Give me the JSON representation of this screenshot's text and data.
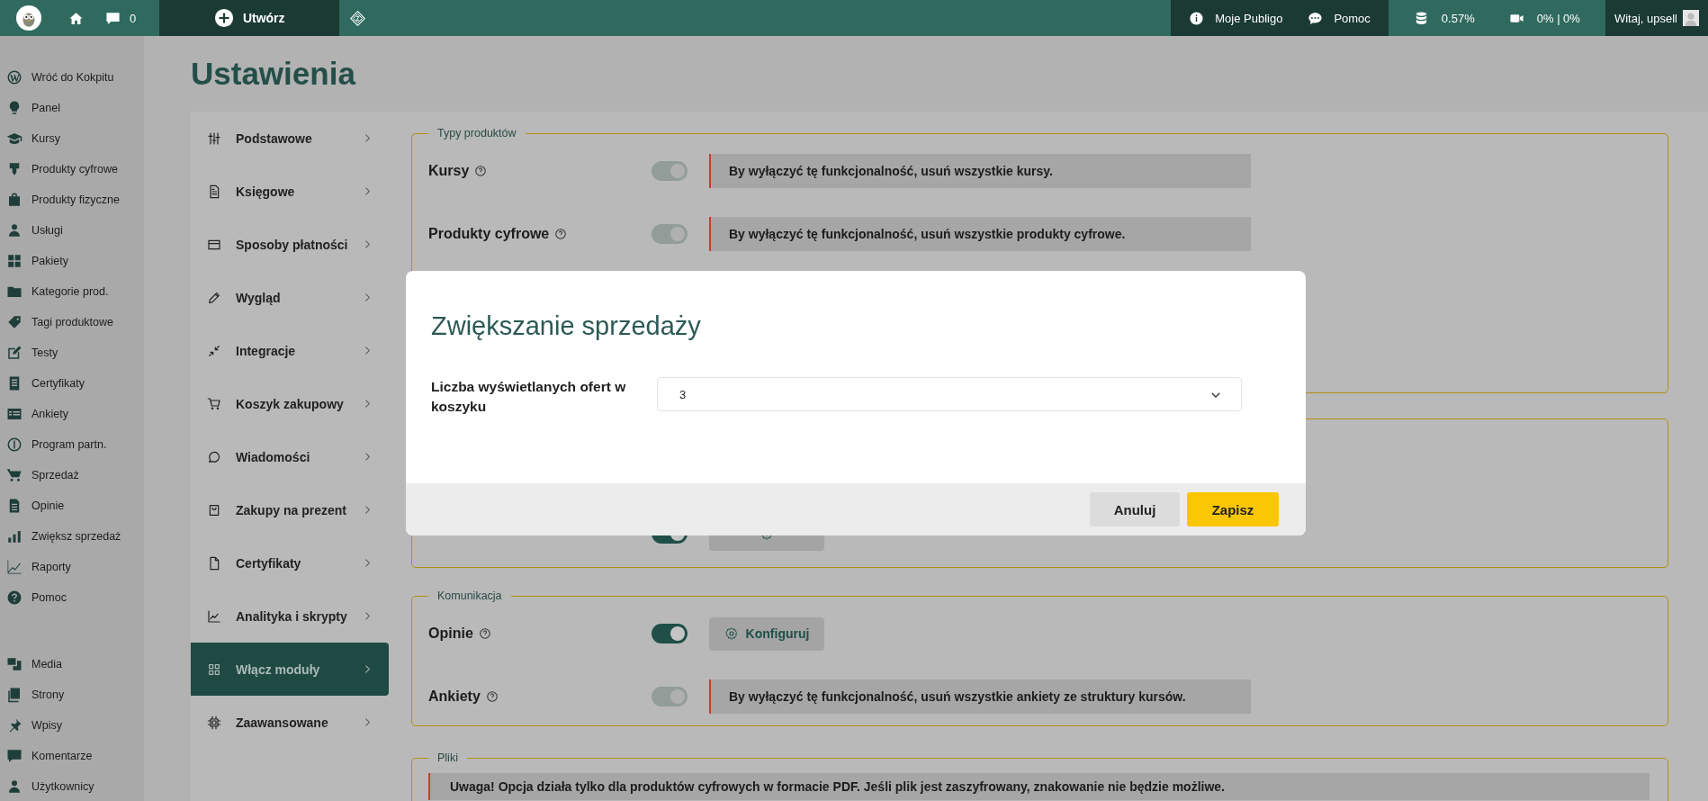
{
  "topbar": {
    "comments_count": "0",
    "create_label": "Utwórz",
    "links": [
      "Moje Publigo",
      "Pomoc"
    ],
    "storage": "0.57%",
    "video": "0% | 0%",
    "greeting": "Witaj, upsell"
  },
  "sidebar": {
    "groups": [
      {
        "items": [
          "Wróć do Kokpitu",
          "Panel",
          "Kursy",
          "Produkty cyfrowe",
          "Produkty fizyczne",
          "Usługi",
          "Pakiety",
          "Kategorie prod.",
          "Tagi produktowe",
          "Testy",
          "Certyfikaty",
          "Ankiety",
          "Program partn.",
          "Sprzedaż",
          "Opinie",
          "Zwiększ sprzedaż",
          "Raporty",
          "Pomoc"
        ]
      },
      {
        "items": [
          "Media",
          "Strony",
          "Wpisy",
          "Komentarze",
          "Użytkownicy"
        ]
      }
    ]
  },
  "page": {
    "title": "Ustawienia"
  },
  "settings_nav": [
    {
      "label": "Podstawowe",
      "selected": false
    },
    {
      "label": "Księgowe",
      "selected": false
    },
    {
      "label": "Sposoby płatności",
      "selected": false
    },
    {
      "label": "Wygląd",
      "selected": false
    },
    {
      "label": "Integracje",
      "selected": false
    },
    {
      "label": "Koszyk zakupowy",
      "selected": false
    },
    {
      "label": "Wiadomości",
      "selected": false
    },
    {
      "label": "Zakupy na prezent",
      "selected": false
    },
    {
      "label": "Certyfikaty",
      "selected": false
    },
    {
      "label": "Analityka i skrypty",
      "selected": false
    },
    {
      "label": "Włącz moduły",
      "selected": true
    },
    {
      "label": "Zaawansowane",
      "selected": false
    }
  ],
  "sections": [
    {
      "legend": "Typy produktów",
      "rows": [
        {
          "kind": "notice",
          "label": "Kursy",
          "on": true,
          "disabled": true,
          "text": "By wyłączyć tę funkcjonalność, usuń wszystkie kursy."
        },
        {
          "kind": "notice",
          "label": "Produkty cyfrowe",
          "on": true,
          "disabled": true,
          "text": "By wyłączyć tę funkcjonalność, usuń wszystkie produkty cyfrowe."
        }
      ]
    },
    {
      "rows": [
        {
          "kind": "button",
          "on": true
        }
      ]
    },
    {
      "legend": "Komunikacja",
      "rows": [
        {
          "kind": "button",
          "label": "Opinie",
          "on": true,
          "disabled": false,
          "button": "Konfiguruj"
        },
        {
          "kind": "notice",
          "label": "Ankiety",
          "on": true,
          "disabled": true,
          "text": "By wyłączyć tę funkcjonalność, usuń wszystkie ankiety ze struktury kursów."
        }
      ]
    },
    {
      "legend": "Pliki",
      "rows": [
        {
          "kind": "warning",
          "text": "Uwaga! Opcja działa tylko dla produktów cyfrowych w formacie PDF. Jeśli plik jest zaszyfrowany, znakowanie nie będzie możliwe."
        }
      ]
    }
  ],
  "modal": {
    "title": "Zwiększanie sprzedaży",
    "field_label": "Liczba wyświetlanych ofert w koszyku",
    "value": "3",
    "cancel": "Anuluj",
    "save": "Zapisz"
  }
}
